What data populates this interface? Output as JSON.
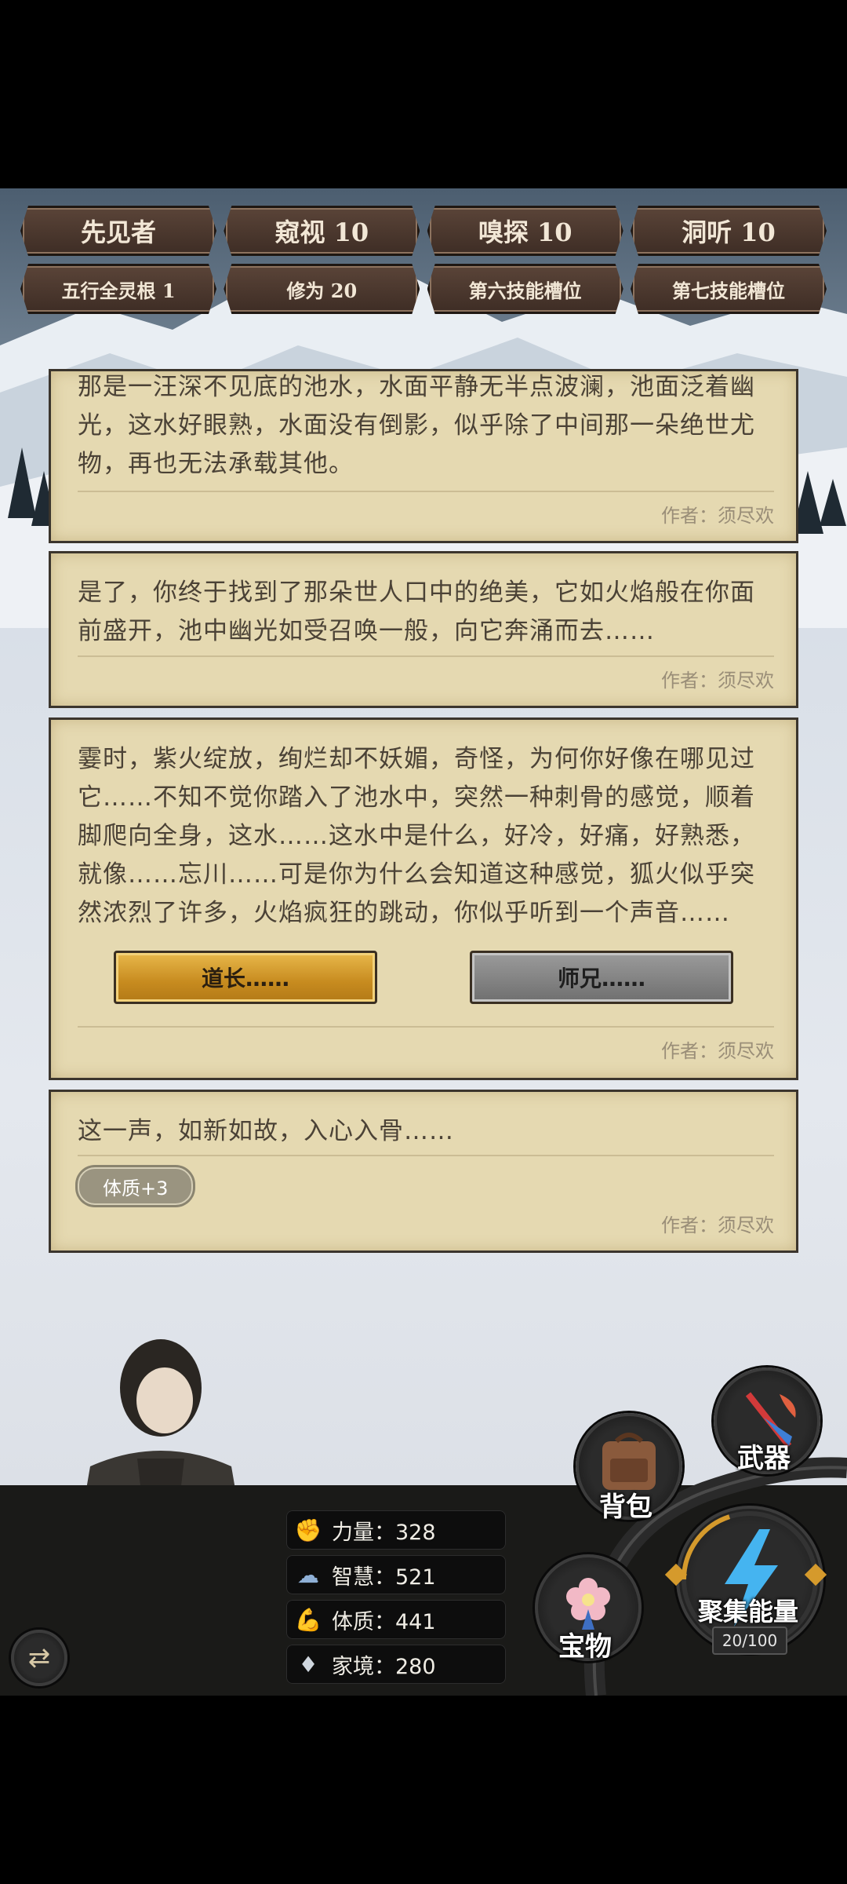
{
  "skills_row1": [
    "先见者",
    "窥视 10",
    "嗅探 10",
    "洞听 10"
  ],
  "skills_row2": [
    "五行全灵根 1",
    "修为 20",
    "第六技能槽位",
    "第七技能槽位"
  ],
  "cards": [
    {
      "text": "那是一汪深不见底的池水，水面平静无半点波澜，池面泛着幽光，这水好眼熟，水面没有倒影，似乎除了中间那一朵绝世尤物，再也无法承载其他。",
      "author": "作者：须尽欢"
    },
    {
      "text": "是了，你终于找到了那朵世人口中的绝美，它如火焰般在你面前盛开，池中幽光如受召唤一般，向它奔涌而去……",
      "author": "作者：须尽欢"
    },
    {
      "text": "霎时，紫火绽放，绚烂却不妖媚，奇怪，为何你好像在哪见过它……不知不觉你踏入了池水中，突然一种刺骨的感觉，顺着脚爬向全身，这水……这水中是什么，好冷，好痛，好熟悉，就像……忘川……可是你为什么会知道这种感觉，狐火似乎突然浓烈了许多，火焰疯狂的跳动，你似乎听到一个声音……",
      "author": "作者：须尽欢",
      "choice_a": "道长……",
      "choice_b": "师兄……"
    },
    {
      "text": "这一声，如新如故，入心入骨……",
      "author": "作者：须尽欢",
      "buff": "体质+3"
    }
  ],
  "stats": [
    {
      "icon": "fist-icon",
      "text": "力量：328"
    },
    {
      "icon": "brain-icon",
      "text": "智慧：521"
    },
    {
      "icon": "arm-icon",
      "text": "体质：441"
    },
    {
      "icon": "diamond-icon",
      "text": "家境：280"
    }
  ],
  "actions": {
    "weapon": "武器",
    "backpack": "背包",
    "treasure": "宝物",
    "gather": "聚集能量",
    "energy": "20/100",
    "energy_fraction": 0.2
  },
  "colors": {
    "card_bg": "#e5d9b1",
    "skill_bg": "#4b382e",
    "gold": "#d59a2c",
    "bar_bg": "#1a1a18"
  }
}
